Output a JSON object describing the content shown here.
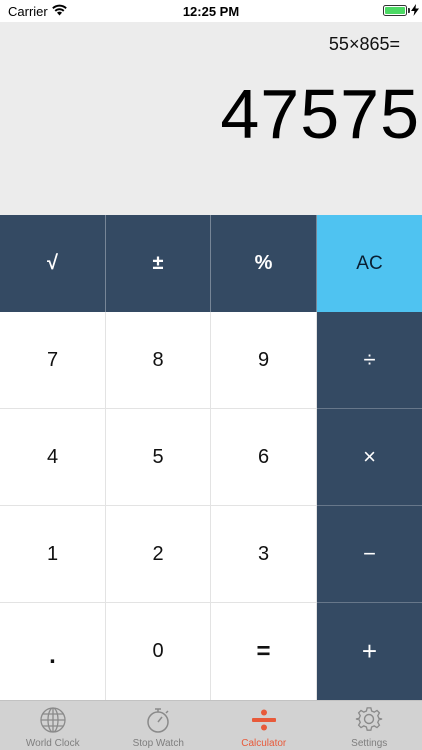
{
  "status_bar": {
    "carrier": "Carrier",
    "time": "12:25 PM"
  },
  "display": {
    "expression": "55×865=",
    "result": "47575"
  },
  "keys": {
    "sqrt": "√",
    "plus_minus": "±",
    "percent": "%",
    "clear": "AC",
    "seven": "7",
    "eight": "8",
    "nine": "9",
    "divide": "÷",
    "four": "4",
    "five": "5",
    "six": "6",
    "multiply": "×",
    "one": "1",
    "two": "2",
    "three": "3",
    "minus": "−",
    "dot": ".",
    "zero": "0",
    "equals": "=",
    "plus": "+"
  },
  "tabs": [
    {
      "label": "World Clock",
      "icon": "globe-icon",
      "active": false
    },
    {
      "label": "Stop Watch",
      "icon": "stopwatch-icon",
      "active": false
    },
    {
      "label": "Calculator",
      "icon": "divide-icon",
      "active": true
    },
    {
      "label": "Settings",
      "icon": "gear-icon",
      "active": false
    }
  ],
  "colors": {
    "function_key": "#344a63",
    "clear_key": "#4fc3f1",
    "display_bg": "#ececec",
    "active_tab": "#e85a3a",
    "tab_bar": "#d2d2d2"
  }
}
